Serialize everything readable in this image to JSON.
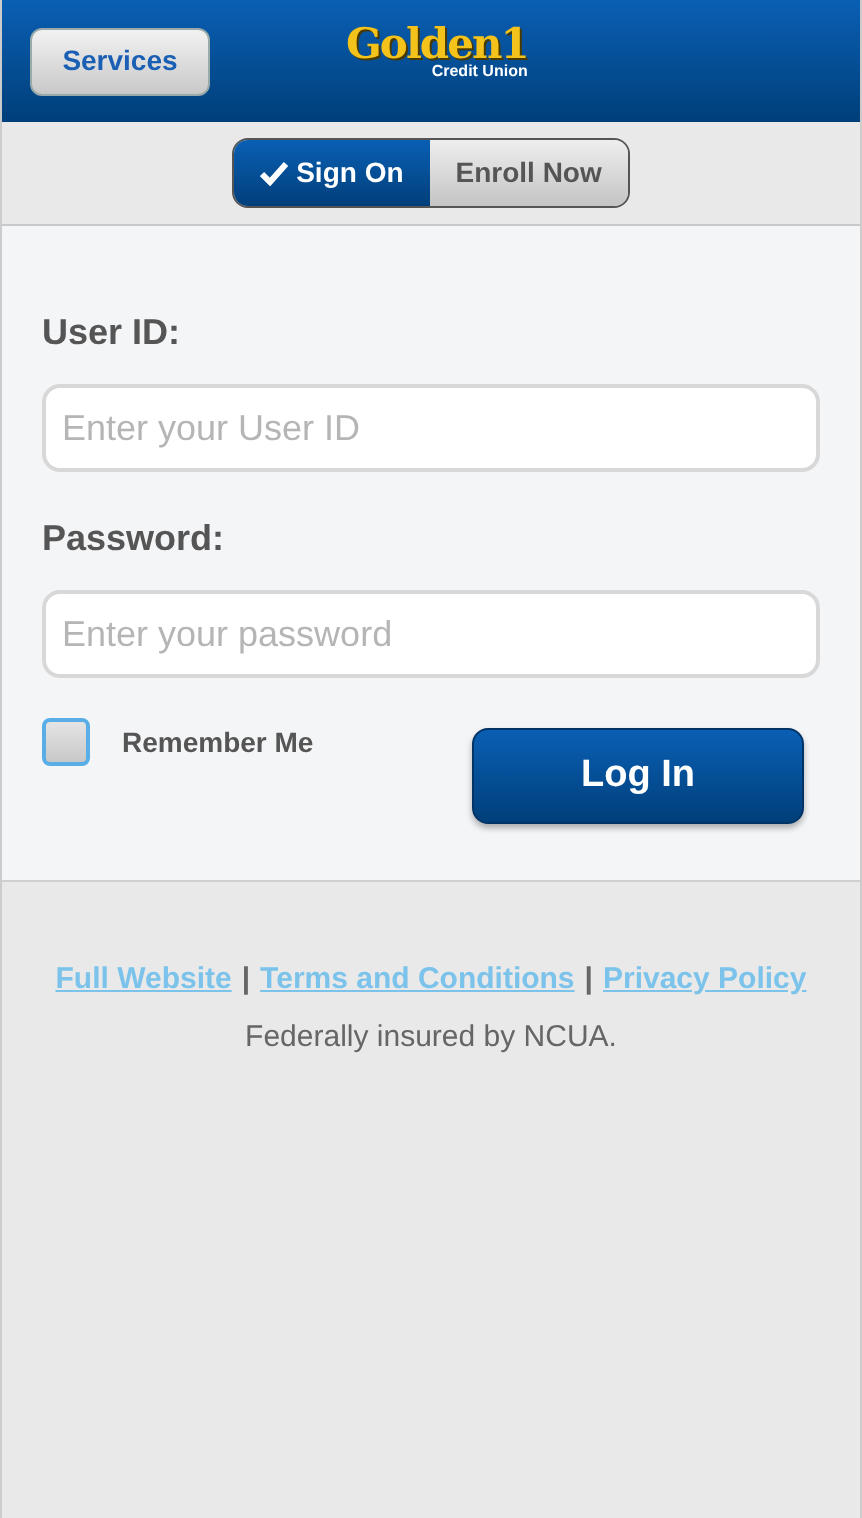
{
  "header": {
    "services_button": "Services",
    "logo": {
      "name": "Golden1",
      "subtitle": "Credit Union"
    }
  },
  "tabs": [
    {
      "label": "Sign On",
      "selected": true
    },
    {
      "label": "Enroll Now",
      "selected": false
    }
  ],
  "form": {
    "fields": [
      {
        "label": "User ID:",
        "placeholder": "Enter your User ID"
      },
      {
        "label": "Password:",
        "placeholder": "Enter your password"
      }
    ],
    "remember_me": {
      "label": "Remember Me",
      "checked": false
    },
    "login_button": "Log In"
  },
  "footer": {
    "links": [
      {
        "kind": "link",
        "text": "Full Website"
      },
      {
        "kind": "separator",
        "text": "|"
      },
      {
        "kind": "link",
        "text": "Terms and Conditions"
      },
      {
        "kind": "separator",
        "text": "|"
      },
      {
        "kind": "link",
        "text": "Privacy Policy"
      }
    ],
    "note": "Federally insured by NCUA."
  }
}
